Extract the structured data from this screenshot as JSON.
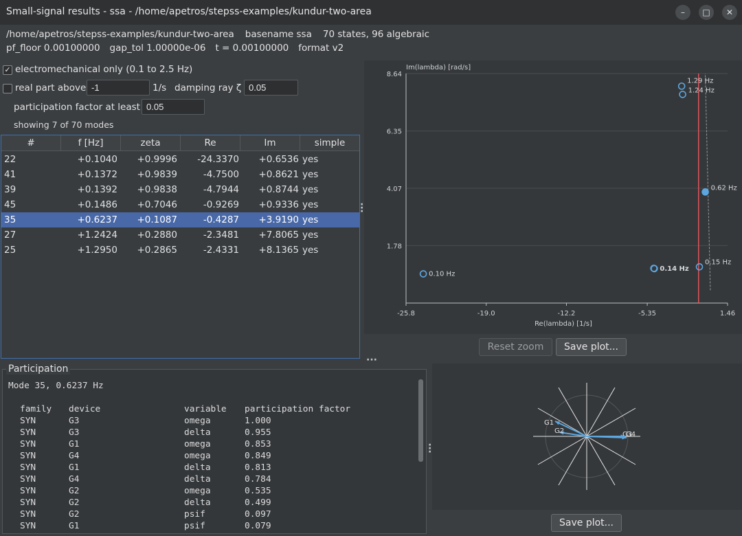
{
  "window": {
    "title": "Small-signal results - ssa - /home/apetros/stepss-examples/kundur-two-area",
    "minimize_label": "–",
    "maximize_label": "□",
    "close_label": "✕"
  },
  "info": {
    "path": "/home/apetros/stepss-examples/kundur-two-area",
    "basename": "basename ssa",
    "states": "70 states, 96 algebraic",
    "pf_floor": "pf_floor 0.00100000",
    "gap_tol": "gap_tol 1.00000e-06",
    "t": "t = 0.00100000",
    "format": "format v2"
  },
  "filters": {
    "electromech_checked": true,
    "electromech_label": "electromechanical only (0.1 to 2.5 Hz)",
    "realpart_checked": false,
    "realpart_label": "real part above",
    "realpart_value": "-1",
    "realpart_unit": "1/s",
    "damping_label": "damping ray ζ",
    "damping_value": "0.05",
    "participation_label": "participation factor at least",
    "participation_value": "0.05",
    "showing": "showing 7 of 70 modes"
  },
  "table": {
    "headers": [
      "#",
      "f [Hz]",
      "zeta",
      "Re",
      "Im",
      "simple"
    ],
    "rows": [
      {
        "num": "22",
        "f": "+0.1040",
        "zeta": "+0.9996",
        "re": "-24.3370",
        "im": "+0.6536",
        "simple": "yes"
      },
      {
        "num": "41",
        "f": "+0.1372",
        "zeta": "+0.9839",
        "re": "-4.7500",
        "im": "+0.8621",
        "simple": "yes"
      },
      {
        "num": "39",
        "f": "+0.1392",
        "zeta": "+0.9838",
        "re": "-4.7944",
        "im": "+0.8744",
        "simple": "yes"
      },
      {
        "num": "45",
        "f": "+0.1486",
        "zeta": "+0.7046",
        "re": "-0.9269",
        "im": "+0.9336",
        "simple": "yes"
      },
      {
        "num": "35",
        "f": "+0.6237",
        "zeta": "+0.1087",
        "re": "-0.4287",
        "im": "+3.9190",
        "simple": "yes"
      },
      {
        "num": "27",
        "f": "+1.2424",
        "zeta": "+0.2880",
        "re": "-2.3481",
        "im": "+7.8065",
        "simple": "yes"
      },
      {
        "num": "25",
        "f": "+1.2950",
        "zeta": "+0.2865",
        "re": "-2.4331",
        "im": "+8.1365",
        "simple": "yes"
      }
    ],
    "selected_num": "35"
  },
  "plot": {
    "reset_zoom_label": "Reset zoom",
    "save_label": "Save plot..."
  },
  "chart_data": {
    "type": "scatter",
    "title": "",
    "xlabel": "Re(lambda)  [1/s]",
    "ylabel": "Im(lambda)  [rad/s]",
    "xlim": [
      -25.8,
      1.46
    ],
    "ylim": [
      -0.51,
      8.64
    ],
    "x_ticks": [
      "-25.8",
      "-19.0",
      "-12.2",
      "-5.35",
      "1.46"
    ],
    "y_ticks": [
      "8.64",
      "6.35",
      "4.07",
      "1.78"
    ],
    "points": [
      {
        "re": -24.337,
        "im": 0.6536,
        "label": "0.10 Hz",
        "selected": false,
        "bold": false
      },
      {
        "re": -4.75,
        "im": 0.8621,
        "label": "0.14 Hz",
        "selected": false,
        "bold": true
      },
      {
        "re": -4.7944,
        "im": 0.8744,
        "label": "",
        "selected": false,
        "bold": false
      },
      {
        "re": -0.9269,
        "im": 0.9336,
        "label": "0.15 Hz",
        "selected": false,
        "bold": false
      },
      {
        "re": -0.4287,
        "im": 3.919,
        "label": "0.62 Hz",
        "selected": true,
        "bold": false
      },
      {
        "re": -2.3481,
        "im": 7.8065,
        "label": "1.24 Hz",
        "selected": false,
        "bold": false
      },
      {
        "re": -2.4331,
        "im": 8.1365,
        "label": "1.29 Hz",
        "selected": false,
        "bold": false
      }
    ],
    "damping_zeta": 0.05,
    "real_threshold": -1,
    "grid": true,
    "colors": {
      "point": "#5da7e0",
      "threshold": "#e0555a",
      "damping": "#9a9a9a",
      "grid": "#4a4d50"
    }
  },
  "participation": {
    "title": "Participation",
    "mode_line": "Mode 35, 0.6237 Hz",
    "headers": [
      "family",
      "device",
      "variable",
      "participation factor"
    ],
    "rows": [
      [
        "SYN",
        "G3",
        "omega",
        "1.000"
      ],
      [
        "SYN",
        "G3",
        "delta",
        "0.955"
      ],
      [
        "SYN",
        "G1",
        "omega",
        "0.853"
      ],
      [
        "SYN",
        "G4",
        "omega",
        "0.849"
      ],
      [
        "SYN",
        "G1",
        "delta",
        "0.813"
      ],
      [
        "SYN",
        "G4",
        "delta",
        "0.784"
      ],
      [
        "SYN",
        "G2",
        "omega",
        "0.535"
      ],
      [
        "SYN",
        "G2",
        "delta",
        "0.499"
      ],
      [
        "SYN",
        "G2",
        "psif",
        "0.097"
      ],
      [
        "SYN",
        "G1",
        "psif",
        "0.079"
      ]
    ],
    "save_label": "Save plot..."
  },
  "compass": {
    "labels": [
      "G1",
      "G2",
      "G3",
      "G4"
    ],
    "color": "#5da7e0"
  }
}
